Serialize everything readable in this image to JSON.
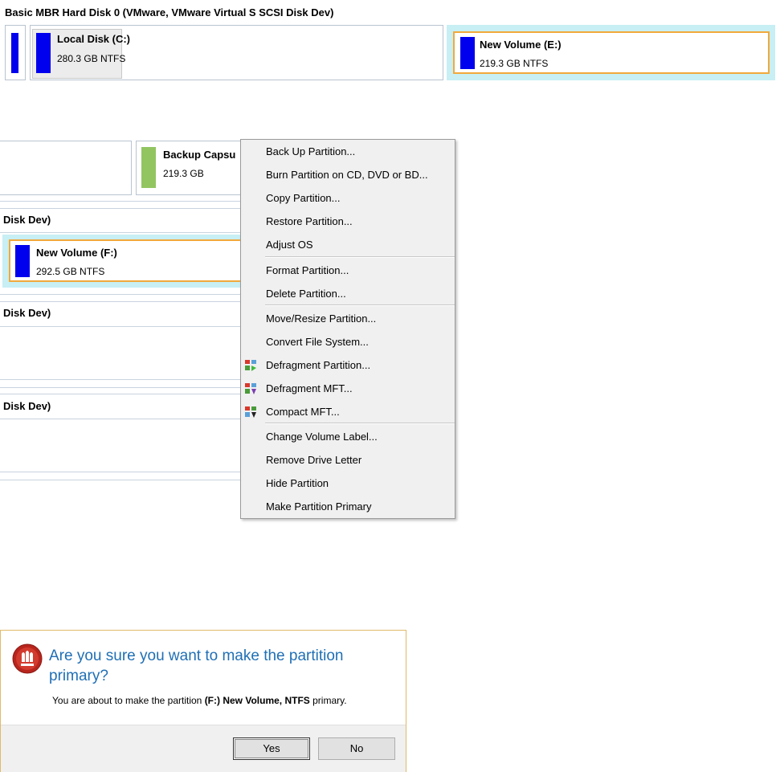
{
  "disk0": {
    "title": "Basic MBR Hard Disk 0 (VMware, VMware Virtual S SCSI Disk Dev)",
    "partitions": [
      {
        "name": "Local Disk (C:)",
        "size": "280.3 GB NTFS"
      },
      {
        "name": "New Volume (E:)",
        "size": "219.3 GB NTFS"
      }
    ]
  },
  "disk1": {
    "partitions": [
      {
        "name": "Backup Capsu",
        "size": "219.3 GB"
      }
    ]
  },
  "disk2": {
    "title": "Disk Dev)",
    "partitions": [
      {
        "name": "New Volume (F:)",
        "size": "292.5 GB NTFS"
      }
    ]
  },
  "disk3": {
    "title": "Disk Dev)"
  },
  "disk4": {
    "title": "Disk Dev)"
  },
  "context_menu": {
    "items": [
      "Back Up Partition...",
      "Burn Partition on CD, DVD or BD...",
      "Copy Partition...",
      "Restore Partition...",
      "Adjust OS",
      "Format Partition...",
      "Delete Partition...",
      "Move/Resize Partition...",
      "Convert File System...",
      "Defragment Partition...",
      "Defragment MFT...",
      "Compact MFT...",
      "Change Volume Label...",
      "Remove Drive Letter",
      "Hide Partition",
      "Make Partition Primary"
    ]
  },
  "dialog": {
    "question": "Are you sure you want to make the partition primary?",
    "message_prefix": "You are about to make the partition ",
    "message_bold": "(F:) New Volume, NTFS",
    "message_suffix": " primary.",
    "yes_label": "Yes",
    "no_label": "No"
  },
  "colors": {
    "partition_bar": "#0000ee",
    "backup_bar": "#92c560",
    "selection_border": "#f2a93b",
    "selection_fill": "#c7eff4",
    "dialog_question": "#1f6fb5"
  }
}
